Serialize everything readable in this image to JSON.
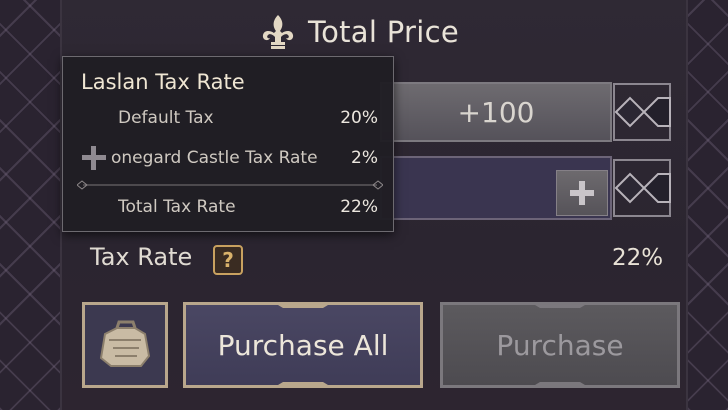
{
  "header": {
    "title": "Total Price",
    "icon": "fleur-de-lis-icon"
  },
  "quantity": {
    "increment_label": "+100"
  },
  "tax": {
    "label": "Tax Rate",
    "help_glyph": "?",
    "value": "22%"
  },
  "buttons": {
    "purchase_all": "Purchase All",
    "purchase": "Purchase",
    "bag_icon": "bag-icon"
  },
  "tooltip": {
    "title": "Laslan Tax Rate",
    "rows": [
      {
        "name": "Default Tax",
        "value": "20%"
      },
      {
        "name": "onegard Castle Tax Rate",
        "value": "2%"
      },
      {
        "name": "Total Tax Rate",
        "value": "22%"
      }
    ]
  },
  "colors": {
    "accent_gold": "#c9a260",
    "button_primary": "#4a4763",
    "button_disabled": "#5c5a5e",
    "panel": "#2e2731"
  }
}
